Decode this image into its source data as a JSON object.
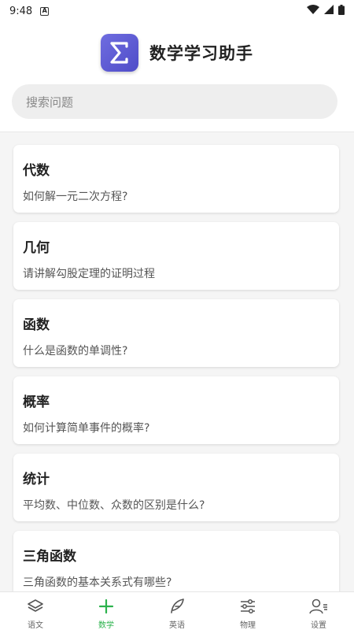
{
  "status_bar": {
    "time": "9:48",
    "app_indicator": "A",
    "icons": [
      "wifi-icon",
      "signal-icon",
      "battery-icon"
    ]
  },
  "header": {
    "title": "数学学习助手",
    "logo_symbol": "Σ"
  },
  "search": {
    "placeholder": "搜索问题"
  },
  "cards": [
    {
      "title": "代数",
      "question": "如何解一元二次方程?"
    },
    {
      "title": "几何",
      "question": "请讲解勾股定理的证明过程"
    },
    {
      "title": "函数",
      "question": "什么是函数的单调性?"
    },
    {
      "title": "概率",
      "question": "如何计算简单事件的概率?"
    },
    {
      "title": "统计",
      "question": "平均数、中位数、众数的区别是什么?"
    },
    {
      "title": "三角函数",
      "question": "三角函数的基本关系式有哪些?"
    }
  ],
  "bottom_nav": {
    "items": [
      {
        "label": "语文",
        "icon": "layers-icon",
        "active": false
      },
      {
        "label": "数学",
        "icon": "plus-icon",
        "active": true
      },
      {
        "label": "英语",
        "icon": "feather-pen-icon",
        "active": false
      },
      {
        "label": "物理",
        "icon": "sliders-icon",
        "active": false
      },
      {
        "label": "设置",
        "icon": "user-settings-icon",
        "active": false
      }
    ]
  },
  "colors": {
    "accent": "#2bb24c",
    "logo": "#5b59d6"
  }
}
